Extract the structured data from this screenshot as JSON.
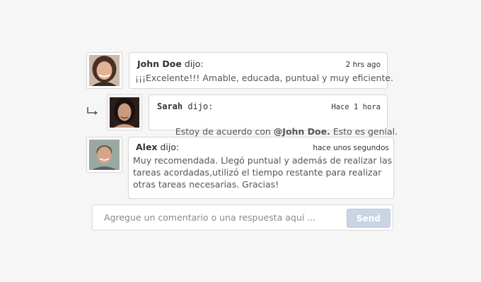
{
  "comments": [
    {
      "author": "John Doe",
      "verb": " dijo:",
      "time": "2 hrs ago",
      "text": "¡¡¡Excelente!!! Amable, educada, puntual y muy eficiente."
    },
    {
      "author": "Sarah",
      "verb": " dijo:",
      "time": "Hace 1 hora",
      "text_before": " Estoy de acuerdo con ",
      "mention": "@John Doe.",
      "text_after": " Esto es genial.",
      "is_reply": true
    },
    {
      "author": "Alex",
      "verb": " dijo:",
      "time": "hace unos segundos",
      "lines": [
        "Muy recomendada. Llegó puntual y además de realizar las",
        "tareas acordadas,utilizó el tiempo restante para realizar",
        "otras tareas necesarias. Gracias!"
      ]
    }
  ],
  "composer": {
    "placeholder": "Agregue un comentario o una respuesta aquí ...",
    "send_label": "Send"
  },
  "colors": {
    "background": "#f6f6f6",
    "send_button": "#c9d5e5",
    "border": "#d9d9d9"
  },
  "icons": [
    "reply-arrow-icon"
  ]
}
